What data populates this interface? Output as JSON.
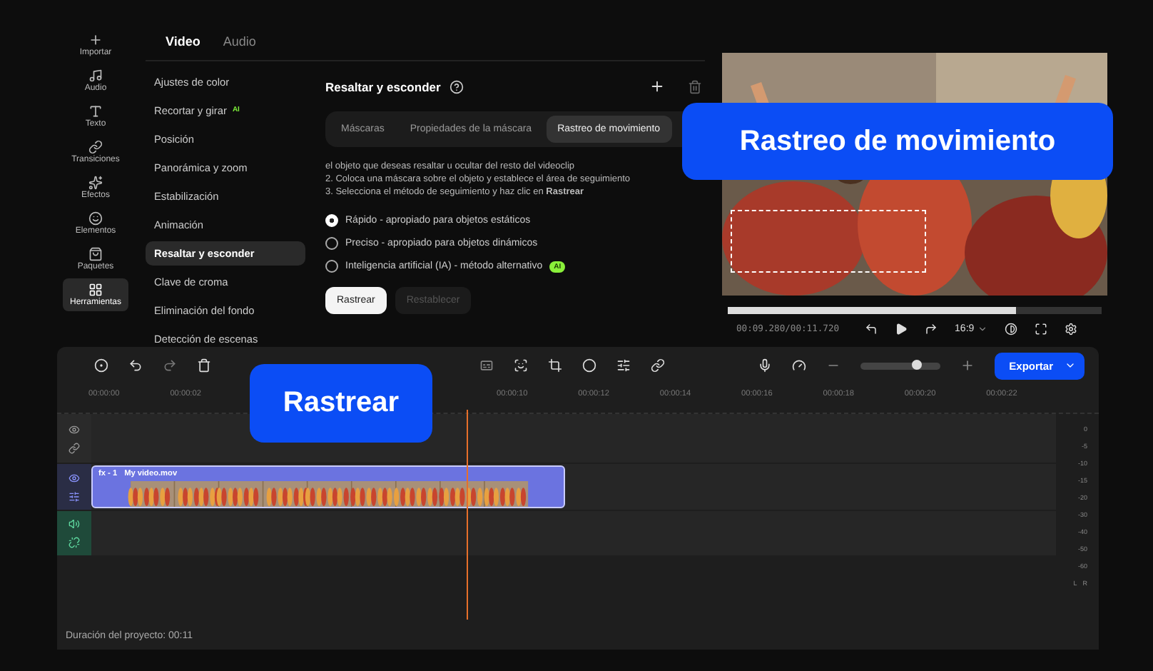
{
  "rail": [
    {
      "label": "Importar",
      "selected": false
    },
    {
      "label": "Audio",
      "selected": false
    },
    {
      "label": "Texto",
      "selected": false
    },
    {
      "label": "Transiciones",
      "selected": false
    },
    {
      "label": "Efectos",
      "selected": false
    },
    {
      "label": "Elementos",
      "selected": false
    },
    {
      "label": "Paquetes",
      "selected": false
    },
    {
      "label": "Herramientas",
      "selected": true
    }
  ],
  "panel_tabs": [
    {
      "label": "Video",
      "selected": true
    },
    {
      "label": "Audio",
      "selected": false
    }
  ],
  "settings": [
    {
      "label": "Ajustes de color",
      "selected": false
    },
    {
      "label": "Recortar y girar",
      "selected": false,
      "badge": "AI"
    },
    {
      "label": "Posición",
      "selected": false
    },
    {
      "label": "Panorámica y zoom",
      "selected": false
    },
    {
      "label": "Estabilización",
      "selected": false
    },
    {
      "label": "Animación",
      "selected": false
    },
    {
      "label": "Resaltar y esconder",
      "selected": true
    },
    {
      "label": "Clave de croma",
      "selected": false
    },
    {
      "label": "Eliminación del fondo",
      "selected": false
    },
    {
      "label": "Detección de escenas",
      "selected": false
    }
  ],
  "detail": {
    "title": "Resaltar y esconder",
    "tabs": [
      {
        "label": "Máscaras",
        "selected": false
      },
      {
        "label": "Propiedades de la máscara",
        "selected": false
      },
      {
        "label": "Rastreo de movimiento",
        "selected": true
      }
    ],
    "instructions": [
      "el objeto que deseas resaltar u ocultar del resto del videoclip",
      "2. Coloca una máscara sobre el objeto y establece el área de seguimiento",
      "3. Selecciona el método de seguimiento y haz clic en **Rastrear**"
    ],
    "methods": [
      {
        "label": "Rápido - apropiado para objetos estáticos",
        "selected": true
      },
      {
        "label": "Preciso - apropiado para objetos dinámicos",
        "selected": false
      },
      {
        "label": "Inteligencia artificial (IA) - método alternativo",
        "selected": false,
        "badge": "AI"
      }
    ],
    "buttons": [
      {
        "label": "Rastrear",
        "disabled": false
      },
      {
        "label": "Restablecer",
        "disabled": true
      }
    ]
  },
  "player": {
    "level": 0.77,
    "time": "00:09.280/00:11.720",
    "ratio": "16:9"
  },
  "timeline": {
    "export": "Exportar",
    "zoom": {
      "level": 0.7
    },
    "ruler_start": [
      "00:00:00",
      "00:00:02"
    ],
    "ruler_end": [
      "00:00:10",
      "00:00:12",
      "00:00:14",
      "00:00:16",
      "00:00:18",
      "00:00:20",
      "00:00:22"
    ],
    "tracks": [
      {
        "kind": "empty"
      },
      {
        "kind": "video",
        "fx": "fx - 1",
        "name": "My video.mov"
      },
      {
        "kind": "audio"
      }
    ],
    "meter": [
      "0",
      "-5",
      "-10",
      "-15",
      "-20",
      "-30",
      "-40",
      "-50",
      "-60"
    ],
    "channels": [
      "L",
      "R"
    ],
    "duration": "Duración del proyecto: 00:11"
  },
  "callouts": [
    "Rastreo de movimiento",
    "Rastrear"
  ]
}
